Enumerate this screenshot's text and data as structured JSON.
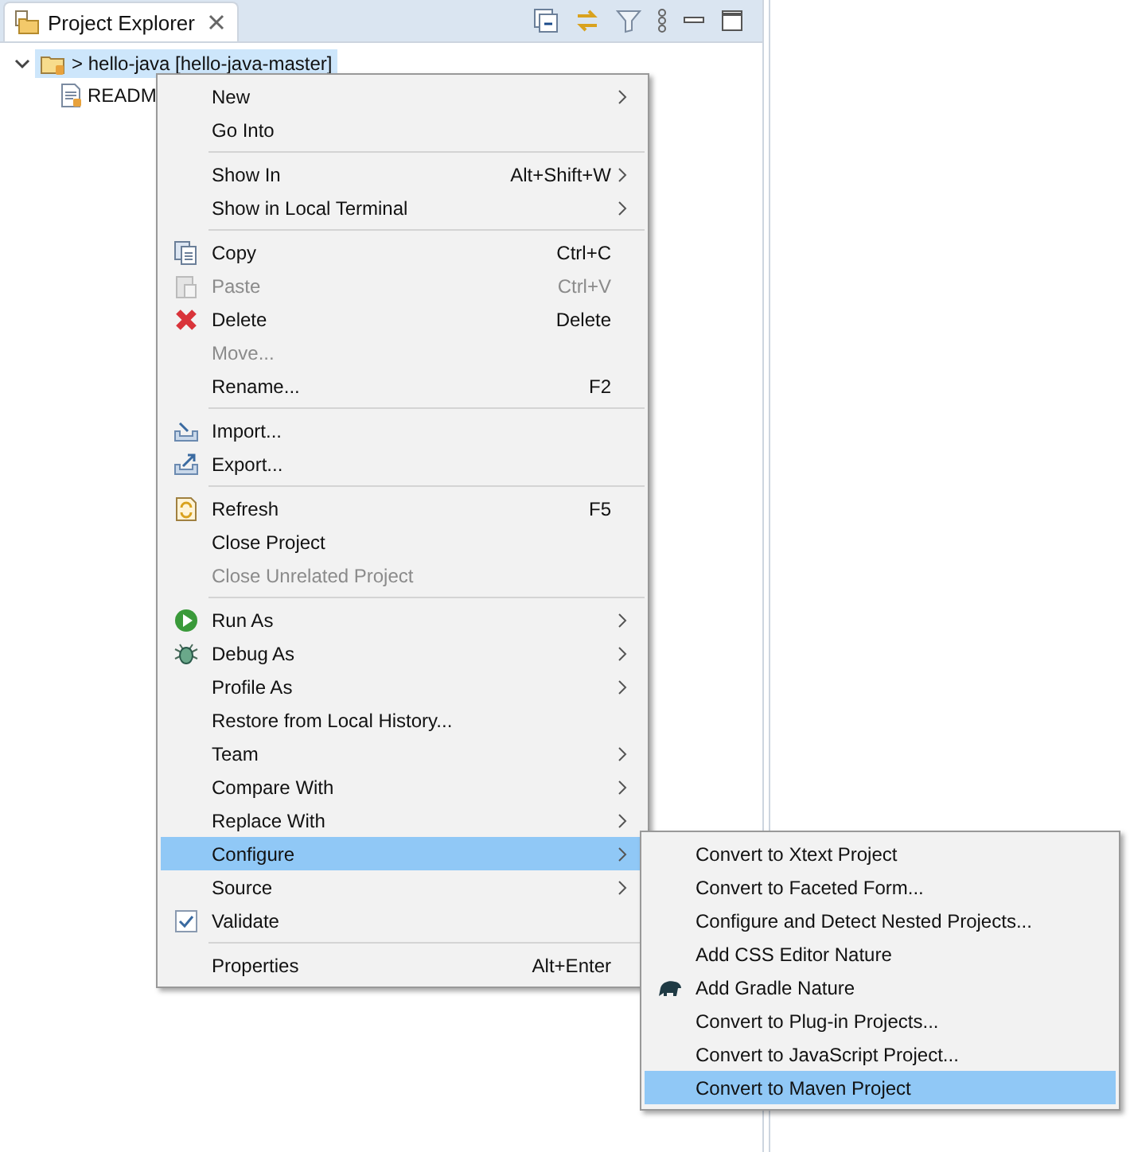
{
  "view": {
    "tab": {
      "title": "Project Explorer",
      "selected": true
    }
  },
  "tree": [
    {
      "label": "> hello-java [hello-java-master]",
      "expanded": true,
      "selected": true,
      "children": [
        {
          "label": "READM",
          "selected": false
        }
      ]
    }
  ],
  "context_menu": [
    {
      "kind": "item",
      "label": "New",
      "submenu": true
    },
    {
      "kind": "item",
      "label": "Go Into"
    },
    {
      "kind": "separator"
    },
    {
      "kind": "item",
      "label": "Show In",
      "shortcut": "Alt+Shift+W",
      "submenu": true
    },
    {
      "kind": "item",
      "label": "Show in Local Terminal",
      "submenu": true
    },
    {
      "kind": "separator"
    },
    {
      "kind": "item",
      "label": "Copy",
      "shortcut": "Ctrl+C"
    },
    {
      "kind": "item",
      "label": "Paste",
      "shortcut": "Ctrl+V",
      "disabled": true
    },
    {
      "kind": "item",
      "label": "Delete",
      "shortcut": "Delete"
    },
    {
      "kind": "item",
      "label": "Move...",
      "disabled": true
    },
    {
      "kind": "item",
      "label": "Rename...",
      "shortcut": "F2"
    },
    {
      "kind": "separator"
    },
    {
      "kind": "item",
      "label": "Import..."
    },
    {
      "kind": "item",
      "label": "Export..."
    },
    {
      "kind": "separator"
    },
    {
      "kind": "item",
      "label": "Refresh",
      "shortcut": "F5"
    },
    {
      "kind": "item",
      "label": "Close Project"
    },
    {
      "kind": "item",
      "label": "Close Unrelated Project",
      "disabled": true
    },
    {
      "kind": "separator"
    },
    {
      "kind": "item",
      "label": "Run As",
      "submenu": true
    },
    {
      "kind": "item",
      "label": "Debug As",
      "submenu": true
    },
    {
      "kind": "item",
      "label": "Profile As",
      "submenu": true
    },
    {
      "kind": "item",
      "label": "Restore from Local History..."
    },
    {
      "kind": "item",
      "label": "Team",
      "submenu": true
    },
    {
      "kind": "item",
      "label": "Compare With",
      "submenu": true
    },
    {
      "kind": "item",
      "label": "Replace With",
      "submenu": true
    },
    {
      "kind": "item",
      "label": "Configure",
      "submenu": true,
      "selected": true
    },
    {
      "kind": "item",
      "label": "Source",
      "submenu": true
    },
    {
      "kind": "item",
      "label": "Validate",
      "checked": true
    },
    {
      "kind": "separator"
    },
    {
      "kind": "item",
      "label": "Properties",
      "shortcut": "Alt+Enter"
    }
  ],
  "submenu": [
    {
      "label": "Convert to Xtext Project",
      "selected": false
    },
    {
      "label": "Convert to Faceted Form...",
      "selected": false
    },
    {
      "label": "Configure and Detect Nested Projects...",
      "selected": false
    },
    {
      "label": "Add CSS Editor Nature",
      "selected": false
    },
    {
      "label": "Add Gradle Nature",
      "selected": false
    },
    {
      "label": "Convert to Plug-in Projects...",
      "selected": false
    },
    {
      "label": "Convert to JavaScript Project...",
      "selected": false
    },
    {
      "label": "Convert to Maven Project",
      "selected": true
    }
  ]
}
